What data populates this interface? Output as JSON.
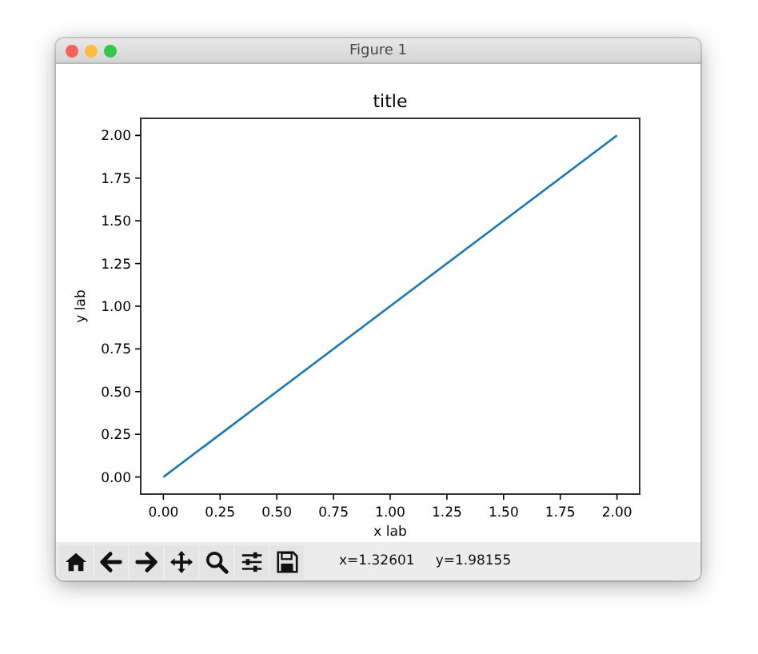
{
  "window": {
    "title": "Figure 1"
  },
  "figure": {
    "chart_data": {
      "type": "line",
      "title": "title",
      "xlabel": "x lab",
      "ylabel": "y lab",
      "x": [
        0,
        2
      ],
      "values": [
        0,
        2
      ],
      "xlim": [
        -0.1,
        2.1
      ],
      "ylim": [
        -0.1,
        2.1
      ],
      "xticks": [
        {
          "value": 0,
          "label": "0.00"
        },
        {
          "value": 0.25,
          "label": "0.25"
        },
        {
          "value": 0.5,
          "label": "0.50"
        },
        {
          "value": 0.75,
          "label": "0.75"
        },
        {
          "value": 1,
          "label": "1.00"
        },
        {
          "value": 1.25,
          "label": "1.25"
        },
        {
          "value": 1.5,
          "label": "1.50"
        },
        {
          "value": 1.75,
          "label": "1.75"
        },
        {
          "value": 2,
          "label": "2.00"
        }
      ],
      "yticks": [
        {
          "value": 0,
          "label": "0.00"
        },
        {
          "value": 0.25,
          "label": "0.25"
        },
        {
          "value": 0.5,
          "label": "0.50"
        },
        {
          "value": 0.75,
          "label": "0.75"
        },
        {
          "value": 1,
          "label": "1.00"
        },
        {
          "value": 1.25,
          "label": "1.25"
        },
        {
          "value": 1.5,
          "label": "1.50"
        },
        {
          "value": 1.75,
          "label": "1.75"
        },
        {
          "value": 2,
          "label": "2.00"
        }
      ]
    }
  },
  "toolbar": {
    "buttons": [
      {
        "kind": "home"
      },
      {
        "kind": "back"
      },
      {
        "kind": "forward"
      },
      {
        "kind": "pan"
      },
      {
        "kind": "zoom"
      },
      {
        "kind": "configure"
      },
      {
        "kind": "save"
      }
    ],
    "coordinates": [
      "x=1.32601",
      "y=1.98155"
    ]
  }
}
